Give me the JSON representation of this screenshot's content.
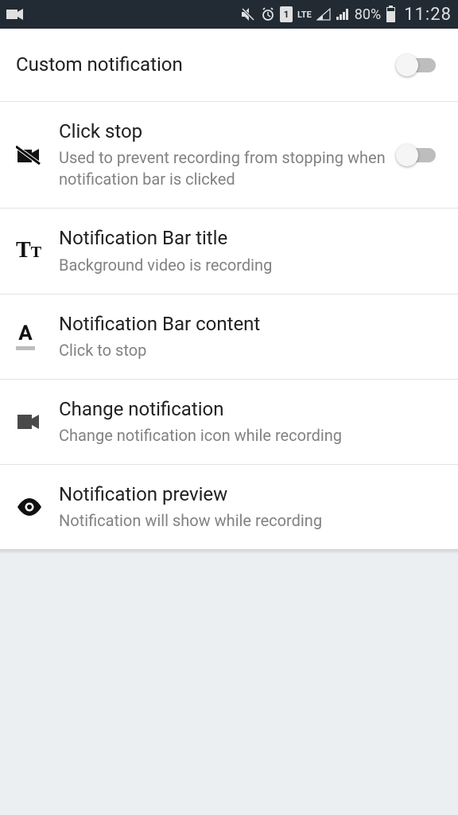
{
  "statusbar": {
    "battery": "80%",
    "time": "11:28",
    "lte": "LTE",
    "sim": "1"
  },
  "settings": {
    "custom_notification": {
      "title": "Custom notification",
      "enabled": false
    },
    "click_stop": {
      "title": "Click stop",
      "subtitle": "Used to prevent recording from stopping when notification bar is clicked",
      "enabled": false
    },
    "bar_title": {
      "title": "Notification Bar title",
      "subtitle": "Background video is recording"
    },
    "bar_content": {
      "title": "Notification Bar content",
      "subtitle": "Click to stop"
    },
    "change_notification": {
      "title": "Change notification",
      "subtitle": "Change notification icon while recording"
    },
    "preview": {
      "title": "Notification preview",
      "subtitle": "Notification will show while recording"
    }
  }
}
